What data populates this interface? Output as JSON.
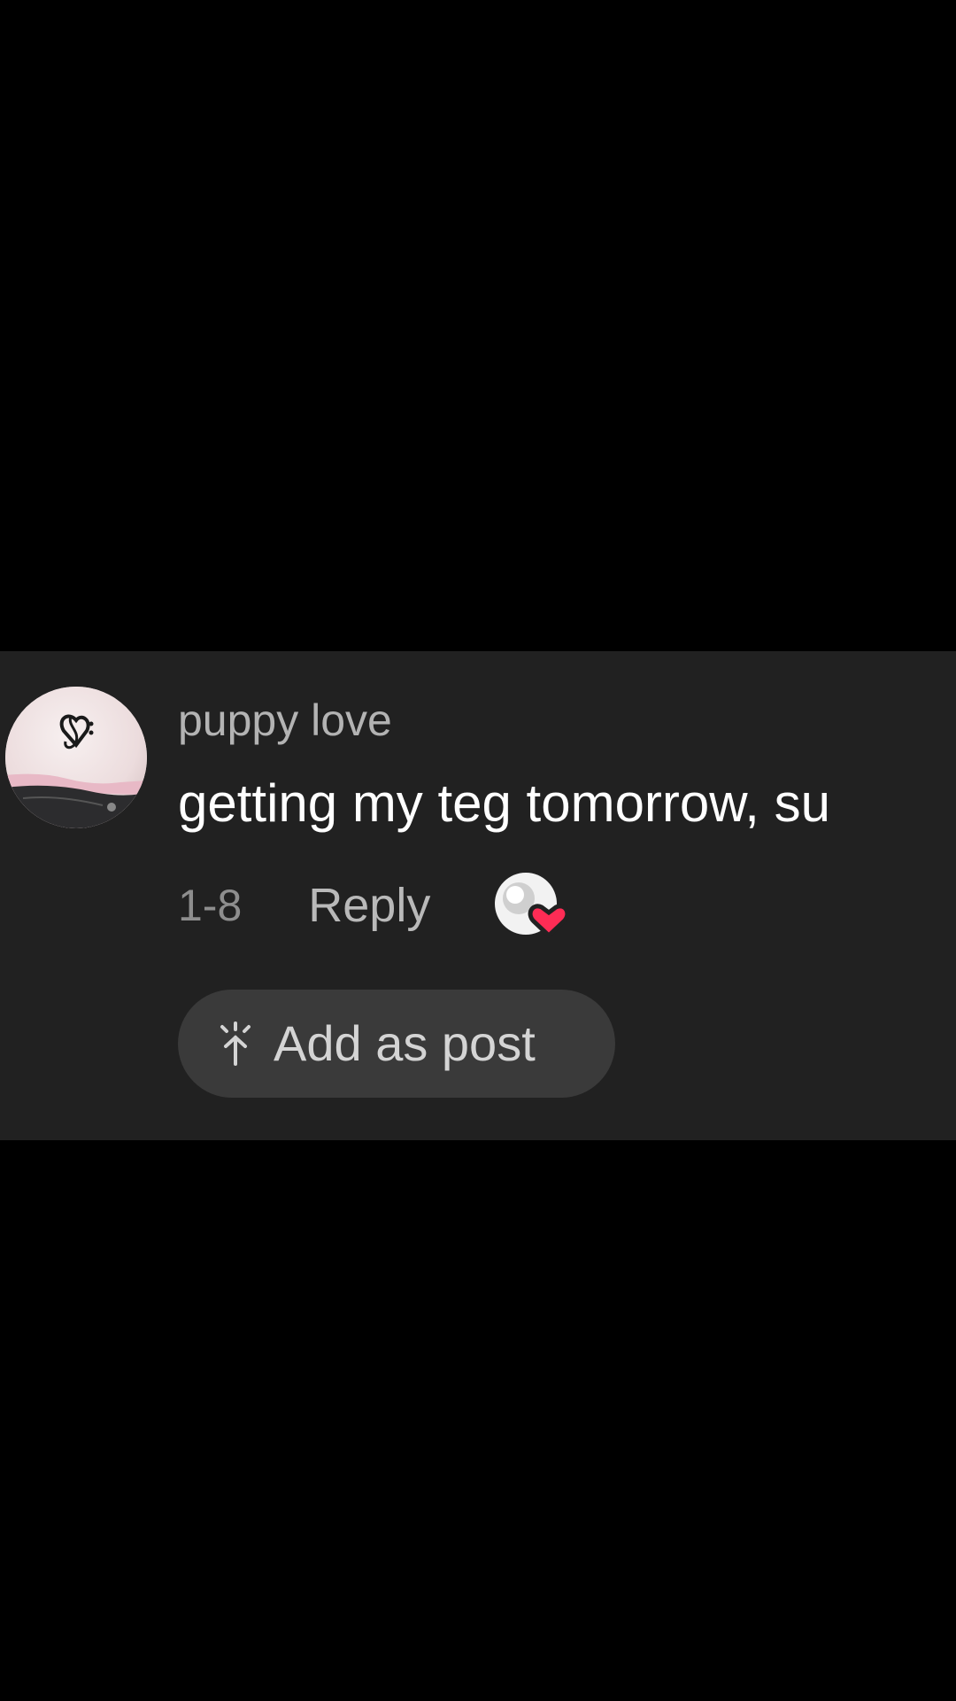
{
  "comment": {
    "username": "puppy love",
    "text": "getting my teg tomorrow, su",
    "timestamp": "1-8",
    "reply_label": "Reply",
    "creator_liked_icon": "creator-liked-heart-icon",
    "add_post_label": "Add as post",
    "add_post_icon": "sparkle-arrow-icon",
    "avatar_icon": "profile-avatar-image"
  },
  "colors": {
    "background": "#000000",
    "card": "#212121",
    "heart": "#fe2c55",
    "button": "#3a3a3a"
  }
}
